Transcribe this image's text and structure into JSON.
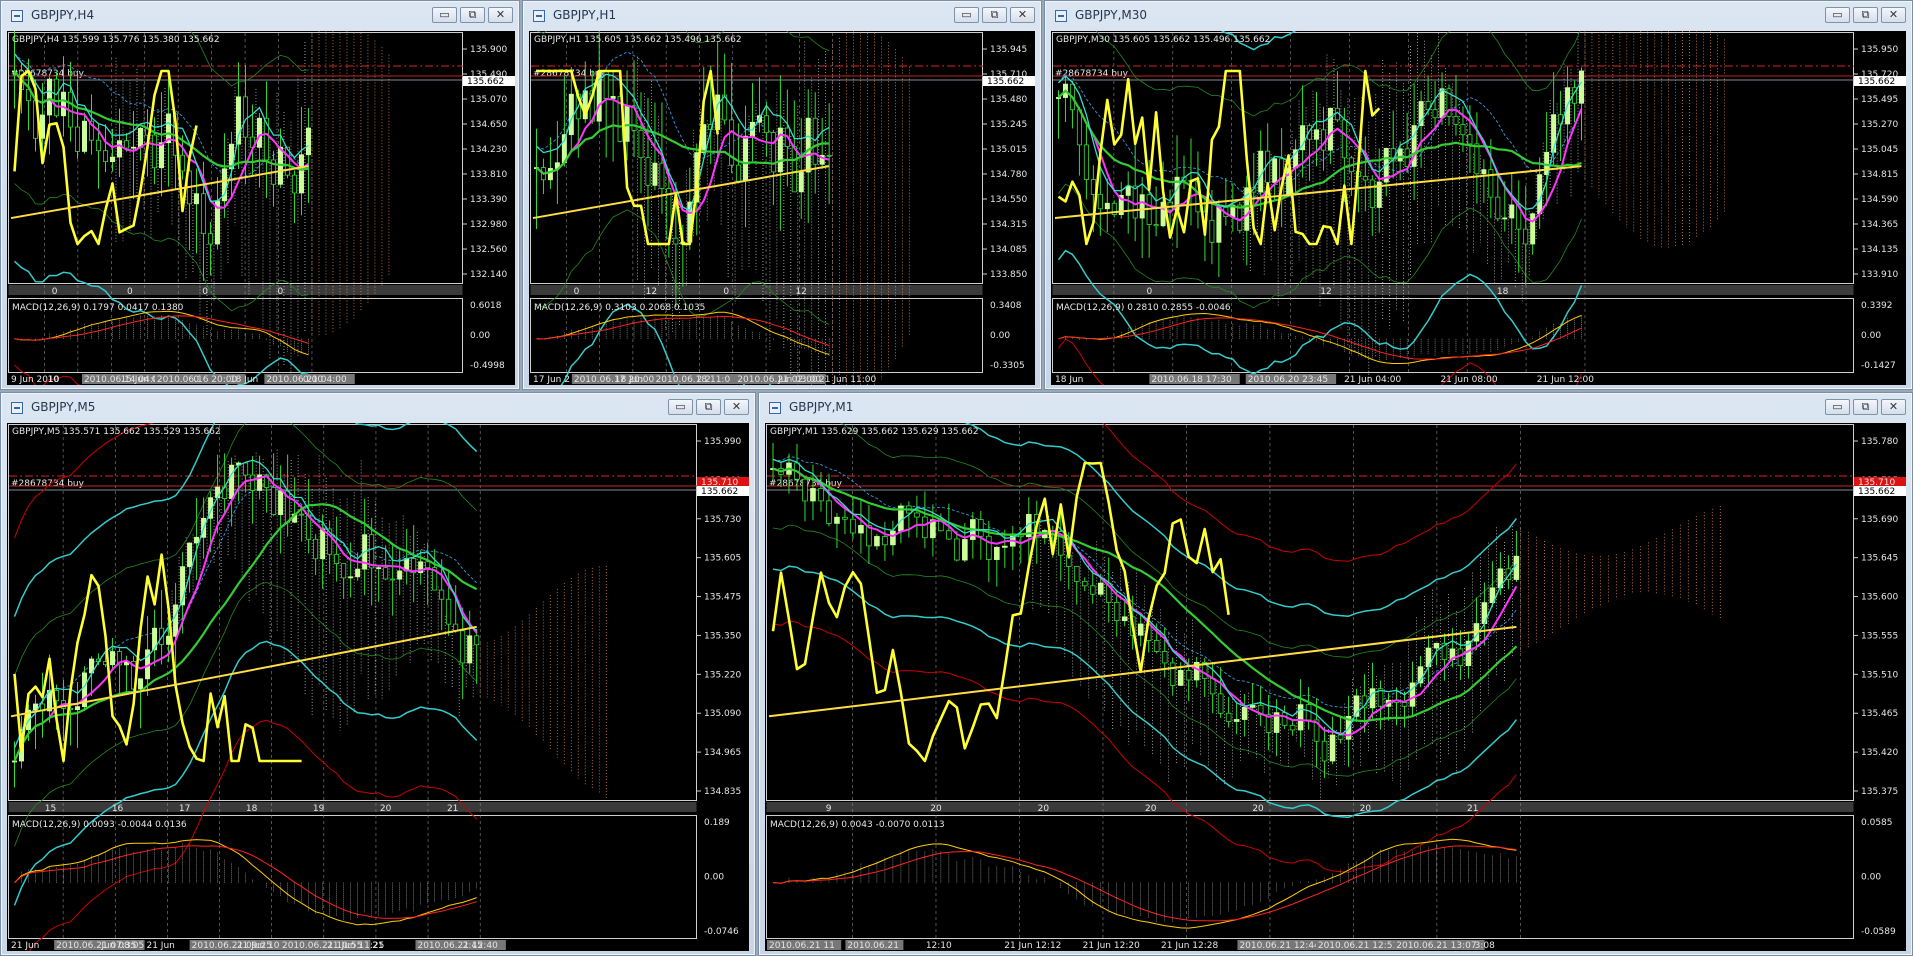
{
  "windows": [
    {
      "title": "GBPJPY,H4",
      "info": "GBPJPY,H4  135.599 135.776 135.380 135.662",
      "order": "#28678734 buy",
      "current_price": "135.662",
      "red_price": "",
      "price_ticks": [
        "135.900",
        "135.490",
        "135.070",
        "134.650",
        "134.230",
        "133.810",
        "133.390",
        "132.980",
        "132.560",
        "132.140"
      ],
      "date_ticks": [
        "0",
        "0",
        "0",
        "0"
      ],
      "macd": "MACD(12,26,9) 0.1797 0.0417 0.1380",
      "macd_ticks": [
        "0.6018",
        "0.00",
        "-0.4998"
      ],
      "bottom_labels": [
        "9 Jun 2010",
        "10",
        "2010.06.14 04:00",
        "15 Jun 0",
        "2010.06.16 20:00",
        "0",
        "18 Jun",
        "2010.06.21 04:00",
        "0:00"
      ]
    },
    {
      "title": "GBPJPY,H1",
      "info": "GBPJPY,H1  135.605 135.662 135.496 135.662",
      "order": "#28678734 buy",
      "current_price": "135.662",
      "red_price": "",
      "price_ticks": [
        "135.945",
        "135.710",
        "135.480",
        "135.245",
        "135.015",
        "134.780",
        "134.550",
        "134.315",
        "134.085",
        "133.850"
      ],
      "date_ticks": [
        "0",
        "12",
        "0",
        "12"
      ],
      "macd": "MACD(12,26,9) 0.3103 0.2068 0.1035",
      "macd_ticks": [
        "0.3408",
        "0.00",
        "-0.3305"
      ],
      "bottom_labels": [
        "17 Jun 2",
        "2010.06.17 20:00",
        "18 Jun",
        "2010.06.18 11:0",
        "2 2",
        "2010.06.21 02:00",
        "Jun 03:00",
        "21 Jun 11:00"
      ]
    },
    {
      "title": "GBPJPY,M30",
      "info": "GBPJPY,M30  135.605 135.662 135.496 135.662",
      "order": "#28678734 buy",
      "current_price": "135.662",
      "red_price": "",
      "price_ticks": [
        "135.950",
        "135.720",
        "135.495",
        "135.270",
        "135.045",
        "134.815",
        "134.590",
        "134.365",
        "134.135",
        "133.910"
      ],
      "date_ticks": [
        "0",
        "12",
        "18"
      ],
      "macd": "MACD(12,26,9) 0.2810 0.2855 -0.0046",
      "macd_ticks": [
        "0.3392",
        "0.00",
        "-0.1427"
      ],
      "bottom_labels": [
        "18 Jun",
        "2010.06.18 17:30",
        "2010.06.20 23:45",
        "21 Jun 04:00",
        "21 Jun 08:00",
        "21 Jun 12:00"
      ]
    },
    {
      "title": "GBPJPY,M5",
      "info": "GBPJPY,M5  135.571 135.662 135.529 135.662",
      "order": "#28678734 buy",
      "current_price": "135.662",
      "red_price": "135.710",
      "price_ticks": [
        "135.990",
        "135.860",
        "135.730",
        "135.605",
        "135.475",
        "135.350",
        "135.220",
        "135.090",
        "134.965",
        "134.835"
      ],
      "date_ticks": [
        "15",
        "16",
        "17",
        "18",
        "19",
        "20",
        "21"
      ],
      "macd": "MACD(12,26,9) 0.0093 -0.0044 0.0136",
      "macd_ticks": [
        "0.189",
        "0.00",
        "-0.0746"
      ],
      "bottom_labels": [
        "21 Jun",
        "2010.06.21 07:35",
        "Jun 08:05",
        "21 Jun",
        "2010.06.21 09:25",
        "21 Jun 10",
        "2010.06.21 10:55",
        "21 Jun 11:25",
        "21",
        "2010.06.21 12:40",
        "2:45"
      ]
    },
    {
      "title": "GBPJPY,M1",
      "info": "GBPJPY,M1  135.629 135.662 135.629 135.662",
      "order": "#28678734 buy",
      "current_price": "135.662",
      "red_price": "135.710",
      "price_ticks": [
        "135.780",
        "135.735",
        "135.690",
        "135.645",
        "135.600",
        "135.555",
        "135.510",
        "135.465",
        "135.420",
        "135.375"
      ],
      "date_ticks": [
        "9",
        "20",
        "20",
        "20",
        "20",
        "20",
        "21"
      ],
      "macd": "MACD(12,26,9) 0.0043 -0.0070 0.0113",
      "macd_ticks": [
        "0.0585",
        "0.00",
        "-0.0589"
      ],
      "bottom_labels": [
        "2010.06.21 11",
        "2010.06.21",
        "12:10",
        "21 Jun 12:12",
        "21 Jun 12:20",
        "21 Jun 12:28",
        "2010.06.21 12:44",
        "2010.06.21 12:51",
        "2010.06.21 13:07",
        "3:08"
      ]
    }
  ],
  "buttons": {
    "minimize": "▭",
    "restore": "⧉",
    "close": "✕"
  },
  "colors": {
    "background": "#000000",
    "candle_bull": "#ccff99",
    "candle_bear": "#229922",
    "ma_fast": "#ff33ff",
    "ma_slow": "#33cc33",
    "bollinger": "#33cccc",
    "zigzag": "#ffff33",
    "envelope": "#cc0000",
    "cloud_white": "#dddddd",
    "cloud_orange": "#ff9955"
  }
}
